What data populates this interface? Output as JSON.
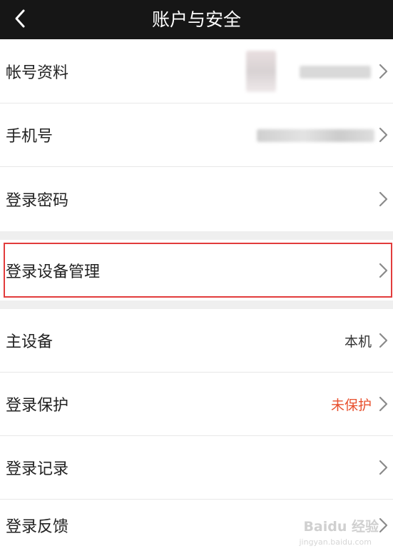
{
  "header": {
    "title": "账户与安全"
  },
  "group1": {
    "items": [
      {
        "label": "帐号资料",
        "value": ""
      },
      {
        "label": "手机号",
        "value": ""
      },
      {
        "label": "登录密码",
        "value": ""
      }
    ]
  },
  "group2": {
    "items": [
      {
        "label": "登录设备管理",
        "value": ""
      }
    ]
  },
  "group3": {
    "items": [
      {
        "label": "主设备",
        "value": "本机"
      },
      {
        "label": "登录保护",
        "value": "未保护",
        "value_color": "#e8502e"
      },
      {
        "label": "登录记录",
        "value": ""
      },
      {
        "label": "登录反馈",
        "value": ""
      }
    ]
  },
  "watermark": {
    "brand": "Baidu 经验",
    "url": "jingyan.baidu.com"
  },
  "colors": {
    "header_bg": "#161616",
    "section_gap": "#efefef",
    "highlight": "#e23c3c",
    "warning_text": "#e8502e"
  }
}
